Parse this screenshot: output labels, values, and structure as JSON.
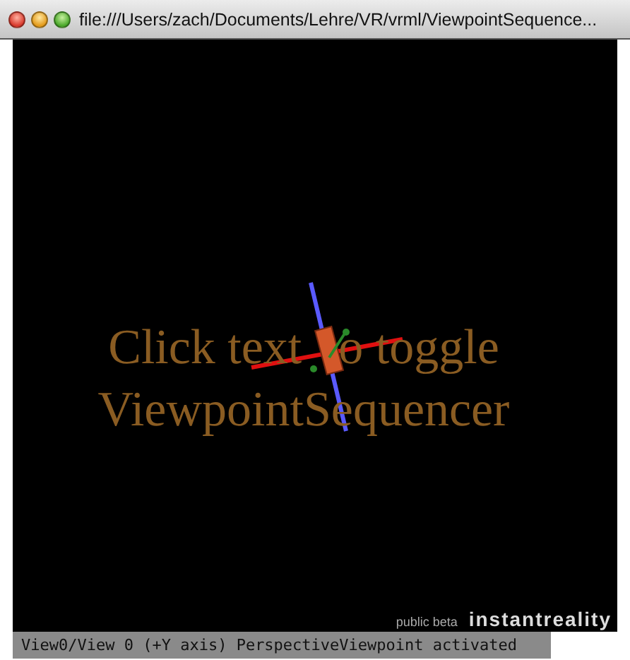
{
  "window": {
    "title": "file:///Users/zach/Documents/Lehre/VR/vrml/ViewpointSequence..."
  },
  "scene": {
    "text_lines": [
      [
        "Click text",
        "o toggle"
      ],
      [
        "ViewpointSequencer"
      ]
    ]
  },
  "logo": {
    "tagline": "public beta",
    "name": "instantreality"
  },
  "status_bar": {
    "text": "View0/View 0 (+Y axis) PerspectiveViewpoint activated"
  }
}
